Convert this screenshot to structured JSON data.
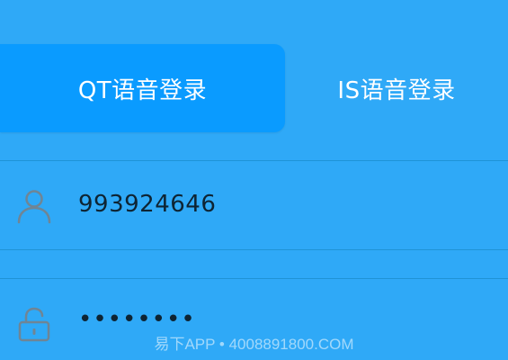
{
  "tabs": [
    {
      "label": "QT语音登录",
      "selected": true
    },
    {
      "label": "IS语音登录",
      "selected": false
    }
  ],
  "form": {
    "username": {
      "icon": "user-icon",
      "value": "993924646"
    },
    "password": {
      "icon": "lock-icon",
      "value": "••••••••"
    }
  },
  "watermark": "易下APP • 4008891800.COM",
  "colors": {
    "background": "#2fa9f7",
    "tab_active": "#0a9bff",
    "divider": "#1f93d6",
    "input_text": "#0e2433",
    "icon": "#6f8595"
  }
}
